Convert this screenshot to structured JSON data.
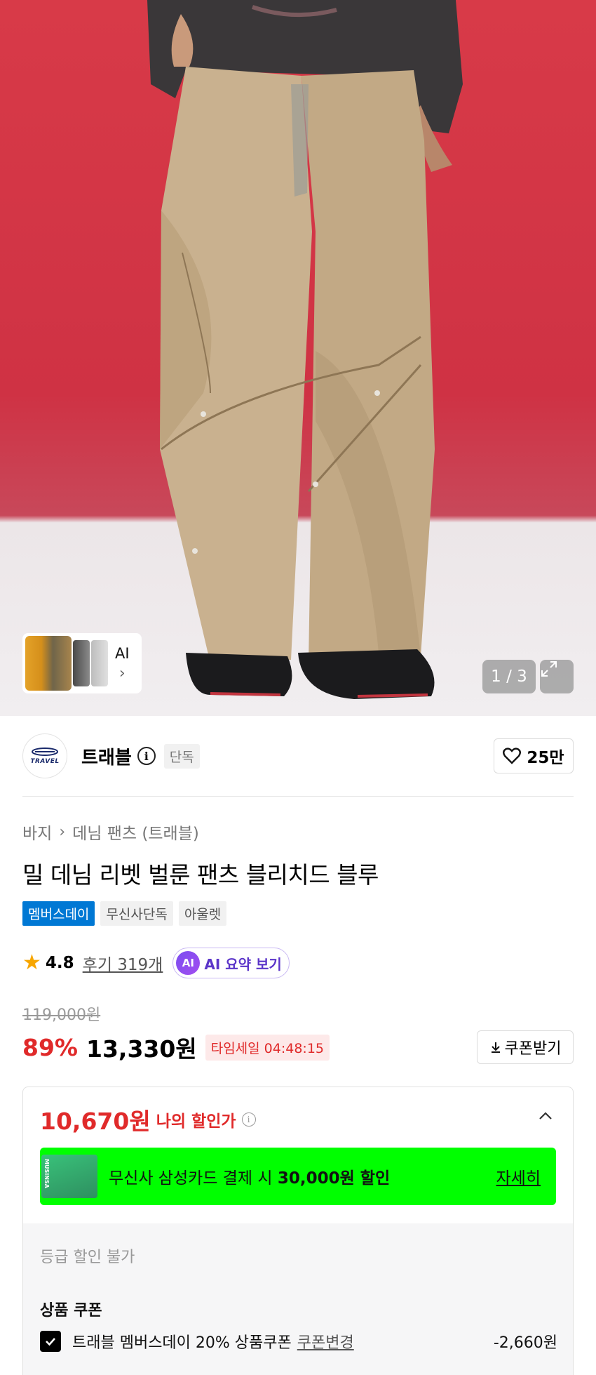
{
  "gallery": {
    "thumb_ai_label": "AI",
    "counter": "1 / 3"
  },
  "brand": {
    "logo_text": "TRAVEL",
    "name": "트래블",
    "badge": "단독",
    "likes": "25만"
  },
  "breadcrumb": {
    "category": "바지",
    "subcategory": "데님 팬츠 (트래블)"
  },
  "product": {
    "title": "밀 데님 리벳 벌룬 팬츠 블리치드 블루",
    "tags": [
      "멤버스데이",
      "무신사단독",
      "아울렛"
    ],
    "rating": "4.8",
    "reviews": "후기 319개",
    "ai_badge": "AI",
    "ai_summary": "AI 요약 보기"
  },
  "pricing": {
    "original_price": "119,000원",
    "discount_rate": "89%",
    "sale_price": "13,330원",
    "time_sale": "타임세일 04:48:15",
    "coupon_button": "쿠폰받기"
  },
  "benefit": {
    "my_price": "10,670원",
    "my_price_label": "나의 할인가",
    "card_image_text": "MUSINSA",
    "card_text_prefix": "무신사 삼성카드 결제 시 ",
    "card_text_amount": "30,000원 할인",
    "card_more": "자세히",
    "grade_notice": "등급 할인 불가",
    "coupon_section": "상품 쿠폰",
    "coupon_name": "트래블 멤버스데이 20% 상품쿠폰",
    "coupon_change": "쿠폰변경",
    "coupon_amount": "-2,660원"
  },
  "colors": {
    "accent_red": "#e02a2a",
    "tag_blue": "#0078d4",
    "card_green": "#00ff00",
    "star": "#f7a600"
  },
  "icons": [
    "info-icon",
    "heart-icon",
    "chevron-right-icon",
    "star-icon",
    "download-icon",
    "chevron-up-icon",
    "expand-icon",
    "check-icon"
  ]
}
